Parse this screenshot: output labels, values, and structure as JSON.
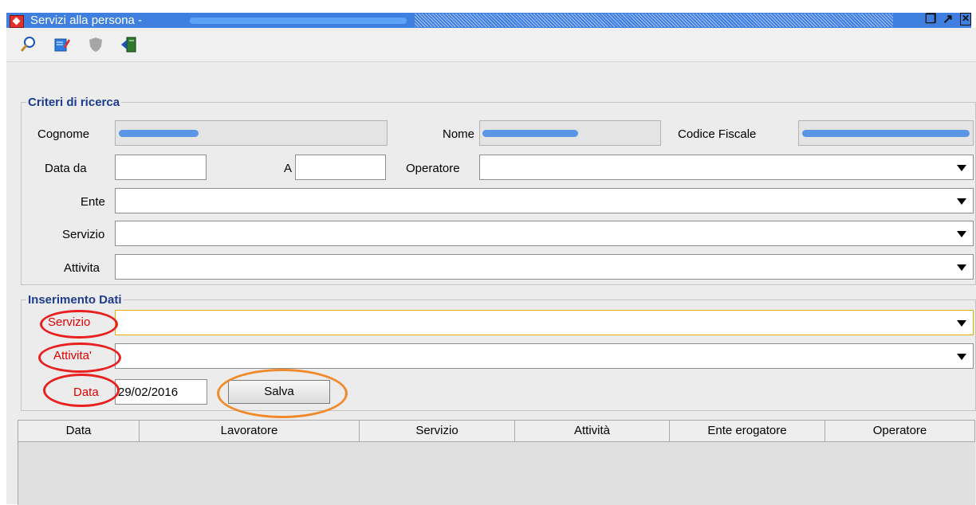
{
  "window": {
    "title": "Servizi alla persona -",
    "app_icon": "app-logo-icon",
    "controls": [
      "restore-icon",
      "maximize-icon",
      "close-icon"
    ]
  },
  "toolbar": {
    "items": [
      {
        "name": "search-icon",
        "glyph": "⌕"
      },
      {
        "name": "edit-icon",
        "glyph": "✎"
      },
      {
        "name": "shield-icon",
        "glyph": "◆"
      },
      {
        "name": "exit-icon",
        "glyph": "⇥"
      }
    ]
  },
  "criteri": {
    "legend": "Criteri di ricerca",
    "cognome_label": "Cognome",
    "nome_label": "Nome",
    "codice_fiscale_label": "Codice Fiscale",
    "data_da_label": "Data da",
    "data_da_value": "",
    "a_label": "A",
    "a_value": "",
    "operatore_label": "Operatore",
    "operatore_value": "",
    "ente_label": "Ente",
    "ente_value": "",
    "servizio_label": "Servizio",
    "servizio_value": "",
    "attivita_label": "Attivita",
    "attivita_value": ""
  },
  "inserimento": {
    "legend": "Inserimento Dati",
    "servizio_label": "Servizio",
    "servizio_value": "",
    "attivita_label": "Attivita'",
    "attivita_value": "",
    "data_label": "Data",
    "data_value": "29/02/2016",
    "save_label": "Salva"
  },
  "table": {
    "columns": [
      "Data",
      "Lavoratore",
      "Servizio",
      "Attività",
      "Ente erogatore",
      "Operatore"
    ],
    "rows": []
  },
  "colors": {
    "titlebar": "#3f7fe0",
    "legend": "#1d3c8f",
    "highlight_red": "#e8201f",
    "highlight_orange": "#f08a2a"
  }
}
